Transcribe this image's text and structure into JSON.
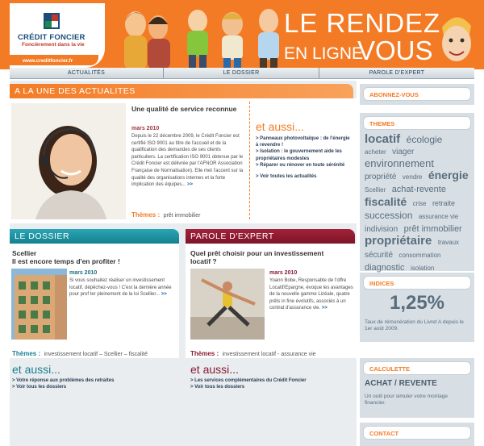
{
  "header": {
    "brand": "CRÉDIT FONCIER",
    "tagline": "Foncièrement dans la vie",
    "url": "www.creditfoncier.fr",
    "headline_line1": "LE RENDEZ",
    "headline_line2a": "EN LIGNE",
    "headline_line2b": "VOUS",
    "colors": {
      "orange": "#f47b25",
      "navy": "#1a4d7a",
      "red": "#c0392b",
      "green": "#1b8a4a"
    }
  },
  "nav": {
    "items": [
      "ACTUALITÉS",
      "LE DOSSIER",
      "PAROLE D'EXPERT"
    ]
  },
  "une": {
    "heading": "A LA UNE DES ACTUALITES",
    "title": "Une qualité de service reconnue",
    "date": "mars 2010",
    "body": "Depuis le 22 décembre 2009, le Crédit Foncier est certifié ISO 9001 au titre de l'accueil et de la qualification des demandes de ses clients particuliers. La certification ISO 9001 obtenue par le Crédit Foncier est délivrée par l'AFNOR Association Française de Normalisation). Elle met l'accent sur la qualité des organisations internes et la forte implication des équipes...",
    "more": ">>",
    "themes_label": "Thèmes :",
    "themes_value": "prêt immobilier",
    "etaussi_title": "et aussi...",
    "etaussi_links": [
      "> Panneaux photovoltaïque : de l'énergie à revendre !",
      "> Isolation : le gouvernement aide les propriétaires modestes",
      "> Réparer ou rénover en toute sérénité"
    ],
    "all_news": "> Voir toutes les actualités"
  },
  "dossier": {
    "heading": "LE DOSSIER",
    "title": "Scellier\nIl est encore temps d'en profiter !",
    "date": "mars 2010",
    "body": "Si vous souhaitez réaliser un investissement locatif, dépêchez-vous ! C'est la dernière année pour prof ter pleinement de la loi Scellier...",
    "more": ">>",
    "themes_label": "Thèmes :",
    "themes_value": "investissement locatif – Scellier – fiscalité",
    "etaussi_title": "et aussi...",
    "links": [
      "> Votre réponse aux problèmes des retraites",
      "> Voir tous les dossiers"
    ]
  },
  "expert": {
    "heading": "PAROLE D'EXPERT",
    "title": "Quel prêt choisir pour un investissement locatif ?",
    "date": "mars 2010",
    "body": "Yoann Bobe, Responsable de l'offre Locatif/Epargne, évoque les avantages de la nouvelle gamme Lizéale, quatre prêts in fine évolutifs, associés à un contrat d'assurance vie.",
    "more": ">>",
    "themes_label": "Thèmes :",
    "themes_value": "investissement locatif - assurance vie",
    "etaussi_title": "et aussi...",
    "links": [
      "> Les services complémentaires du Crédit Foncier",
      "> Voir tous les dossiers"
    ]
  },
  "sidebar": {
    "abonnez": "ABONNEZ-VOUS",
    "themes_head": "THEMES",
    "tags": [
      {
        "t": "locatif",
        "s": 15,
        "b": true
      },
      {
        "t": "écologie",
        "s": 12
      },
      {
        "t": "acheter",
        "s": 8
      },
      {
        "t": "viager",
        "s": 10
      },
      {
        "t": "environnement",
        "s": 13
      },
      {
        "t": "propriété",
        "s": 10
      },
      {
        "t": "vendre",
        "s": 8
      },
      {
        "t": "énergie",
        "s": 14,
        "b": true
      },
      {
        "t": "Scellier",
        "s": 8
      },
      {
        "t": "achat-revente",
        "s": 11
      },
      {
        "t": "fiscalité",
        "s": 14,
        "b": true
      },
      {
        "t": "crise",
        "s": 8
      },
      {
        "t": "retraite",
        "s": 9
      },
      {
        "t": "succession",
        "s": 12
      },
      {
        "t": "assurance vie",
        "s": 8
      },
      {
        "t": "indivision",
        "s": 10
      },
      {
        "t": "prêt immobilier",
        "s": 11
      },
      {
        "t": "propriétaire",
        "s": 15,
        "b": true
      },
      {
        "t": "travaux",
        "s": 8
      },
      {
        "t": "sécurité",
        "s": 10
      },
      {
        "t": "consommation",
        "s": 8
      },
      {
        "t": "diagnostic",
        "s": 11
      },
      {
        "t": "isolation",
        "s": 8
      }
    ],
    "indices_head": "INDICES",
    "rate": "1,25%",
    "rate_caption": "Taux de rémunération du Livret A depuis le 1er août 2009.",
    "calc_head": "CALCULETTE",
    "calc_title": "ACHAT / REVENTE",
    "calc_caption": "Un outil pour simuler votre montage financier.",
    "contact_head": "CONTACT"
  }
}
